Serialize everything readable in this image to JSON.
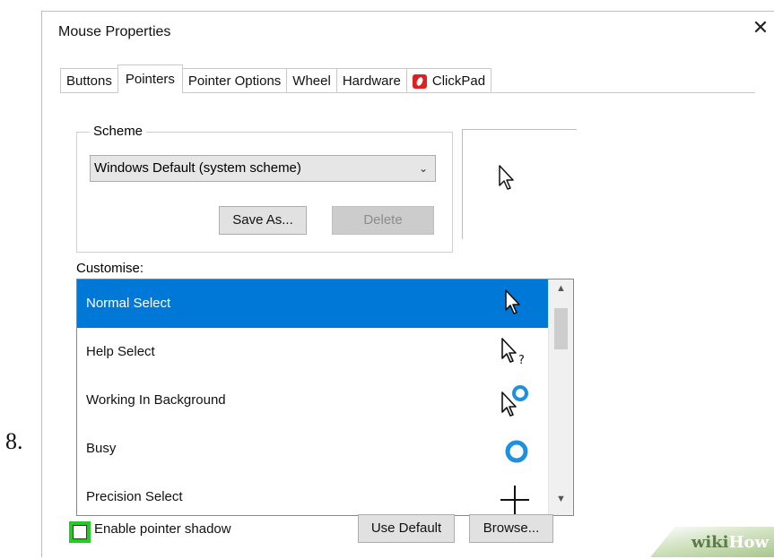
{
  "step": "8.",
  "window": {
    "title": "Mouse Properties",
    "close_glyph": "✕"
  },
  "tabs": [
    {
      "label": "Buttons"
    },
    {
      "label": "Pointers",
      "active": true
    },
    {
      "label": "Pointer Options"
    },
    {
      "label": "Wheel"
    },
    {
      "label": "Hardware"
    },
    {
      "label": "ClickPad",
      "icon": "clickpad-icon"
    }
  ],
  "scheme": {
    "group_label": "Scheme",
    "selected": "Windows Default (system scheme)",
    "save_as_label": "Save As...",
    "delete_label": "Delete"
  },
  "customise": {
    "label": "Customise:",
    "items": [
      {
        "label": "Normal Select",
        "icon": "arrow-cursor-icon",
        "selected": true
      },
      {
        "label": "Help Select",
        "icon": "help-cursor-icon"
      },
      {
        "label": "Working In Background",
        "icon": "working-cursor-icon"
      },
      {
        "label": "Busy",
        "icon": "busy-cursor-icon"
      },
      {
        "label": "Precision Select",
        "icon": "crosshair-cursor-icon"
      }
    ]
  },
  "shadow": {
    "label": "Enable pointer shadow",
    "checked": false
  },
  "buttons": {
    "use_default": "Use Default",
    "browse": "Browse..."
  },
  "watermark": {
    "part1": "wiki",
    "part2": "How"
  },
  "colors": {
    "selection": "#0078d7",
    "highlight": "#22cc22",
    "busy_ring": "#1e90e0"
  }
}
